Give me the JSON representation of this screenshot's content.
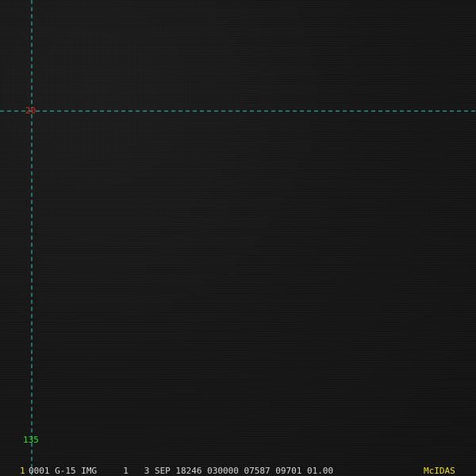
{
  "colors": {
    "background": "#161616",
    "grid_line": "#2fc7c7",
    "latitude_label": "#d42a1c",
    "longitude_label": "#2ee02e",
    "status_text": "#d8d8d8",
    "highlight": "#f0e020"
  },
  "grid": {
    "latitude_label": "20",
    "longitude_label": "135"
  },
  "status_bar": {
    "frame_number": "1",
    "text": "0001 G-15 IMG     1   3 SEP 18246 030000 07587 09701 01.00",
    "brand": "McIDAS"
  }
}
